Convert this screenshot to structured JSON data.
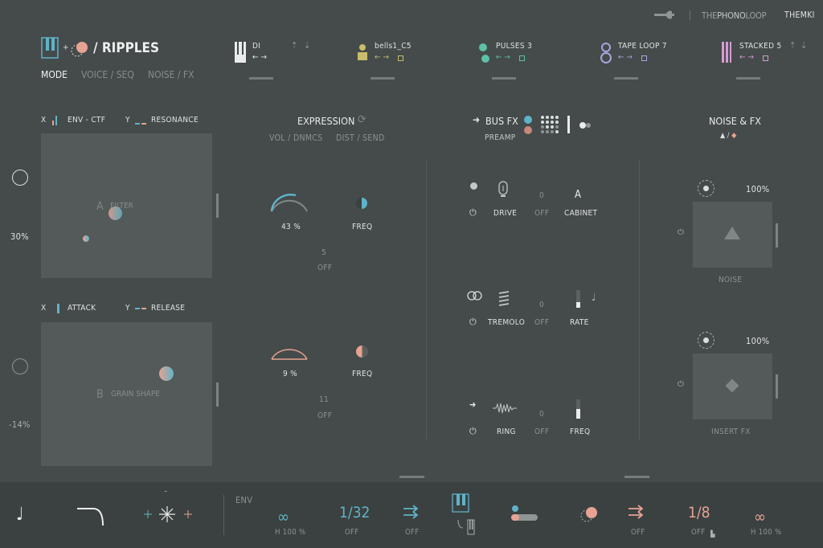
{
  "colors": {
    "bg": "#444b4a",
    "panel": "#535a59",
    "bottom_bar": "#3b4140",
    "teal": "#5fb3c9",
    "salmon": "#e6a393",
    "green": "#5cc1a7",
    "yellow": "#c8bd6a",
    "lavender": "#a7a5e0",
    "pink": "#d79bd6"
  },
  "header": {
    "brand_the": "THE",
    "brand_phono": "PHONO",
    "brand_loop": "LOOP",
    "user": "THEMKI",
    "app_title": "/ RIPPLES",
    "tabs": [
      "MODE",
      "VOICE / SEQ",
      "NOISE / FX"
    ],
    "active_tab": "MODE"
  },
  "tracks": [
    {
      "name": "DI",
      "color": "#e9eceb",
      "icon": "piano-icon",
      "arrows": "← →"
    },
    {
      "name": "bells1_C5",
      "color": "#c8bd6a",
      "icon": "person-icon",
      "arrows": "← →"
    },
    {
      "name": "PULSES 3",
      "color": "#5cc1a7",
      "icon": "dots-icon",
      "arrows": "← →"
    },
    {
      "name": "TAPE LOOP 7",
      "color": "#a7a5e0",
      "icon": "loop-icon",
      "arrows": "← →"
    },
    {
      "name": "STACKED 5",
      "color": "#d79bd6",
      "icon": "stacked-icon",
      "arrows": "← →"
    }
  ],
  "pad_a": {
    "x_label": "X",
    "x_param": "ENV - CTF",
    "y_label": "Y",
    "y_param": "RESONANCE",
    "letter": "A",
    "name": "FILTER"
  },
  "pad_b": {
    "x_label": "X",
    "x_param": "ATTACK",
    "y_label": "Y",
    "y_param": "RELEASE",
    "letter": "B",
    "name": "GRAIN SHAPE"
  },
  "left_values": {
    "top": "30%",
    "bottom": "-14%"
  },
  "expression": {
    "title": "EXPRESSION",
    "sub1": "VOL / DNMCS",
    "sub2": "DIST / SEND",
    "knob1_value": "43 %",
    "knob1_fraction": 0.43,
    "freq1_label": "FREQ",
    "mid1_num": "5",
    "mid1_off": "OFF",
    "knob2_value": "9 %",
    "knob2_fraction": 0.09,
    "freq2_label": "FREQ",
    "mid2_num": "11",
    "mid2_off": "OFF"
  },
  "bus_fx": {
    "title": "BUS FX",
    "subtitle": "PREAMP",
    "row1": {
      "label1": "DRIVE",
      "num": "0",
      "off": "OFF",
      "letter": "A",
      "label2": "CABINET"
    },
    "row2": {
      "label1": "TREMOLO",
      "num": "0",
      "off": "OFF",
      "label2": "RATE"
    },
    "row3": {
      "label1": "RING",
      "num": "0",
      "off": "OFF",
      "label2": "FREQ"
    }
  },
  "noise_fx": {
    "title": "NOISE & FX",
    "noise_pct": "100%",
    "noise_label": "NOISE",
    "insert_pct": "100%",
    "insert_label": "INSERT FX"
  },
  "bottom": {
    "env_label": "ENV",
    "dash": "–",
    "h1": "H  100 %",
    "div1": "1/32",
    "off1": "OFF",
    "off2": "OFF",
    "off3": "OFF",
    "div2": "1/8",
    "off4": "OFF",
    "h2": "H  100 %"
  }
}
